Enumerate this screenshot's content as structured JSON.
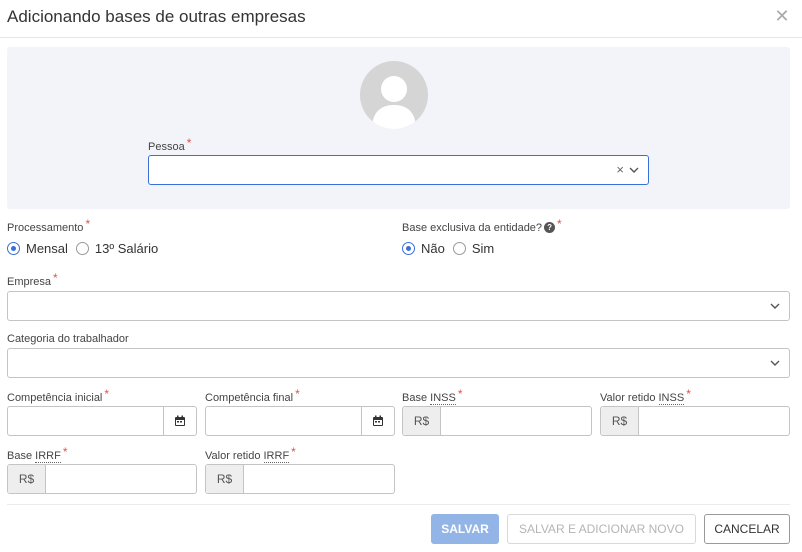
{
  "dialog": {
    "title": "Adicionando bases de outras empresas"
  },
  "pessoa": {
    "label": "Pessoa",
    "required": "*",
    "clear": "×"
  },
  "processamento": {
    "label": "Processamento",
    "required": "*",
    "options": [
      {
        "label": "Mensal",
        "selected": true
      },
      {
        "label": "13º Salário",
        "selected": false
      }
    ]
  },
  "base_exclusiva": {
    "label": "Base exclusiva da entidade?",
    "help": "?",
    "required": "*",
    "options": [
      {
        "label": "Não",
        "selected": true
      },
      {
        "label": "Sim",
        "selected": false
      }
    ]
  },
  "empresa": {
    "label": "Empresa",
    "required": "*"
  },
  "categoria": {
    "label": "Categoria do trabalhador"
  },
  "competencia_inicial": {
    "label": "Competência inicial",
    "required": "*"
  },
  "competencia_final": {
    "label": "Competência final",
    "required": "*"
  },
  "base_inss": {
    "label_pre": "Base ",
    "label_abbr": "INSS",
    "required": "*",
    "prefix": "R$"
  },
  "valor_retido_inss": {
    "label_pre": "Valor retido ",
    "label_abbr": "INSS",
    "required": "*",
    "prefix": "R$"
  },
  "base_irrf": {
    "label_pre": "Base ",
    "label_abbr": "IRRF",
    "required": "*",
    "prefix": "R$"
  },
  "valor_retido_irrf": {
    "label_pre": "Valor retido ",
    "label_abbr": "IRRF",
    "required": "*",
    "prefix": "R$"
  },
  "buttons": {
    "save": "SALVAR",
    "save_new": "SALVAR E ADICIONAR NOVO",
    "cancel": "CANCELAR"
  },
  "colors": {
    "accent": "#3b6fd8",
    "required": "#e0544c",
    "panel_bg": "#f2f4f9",
    "save_disabled": "#93b4e6"
  }
}
